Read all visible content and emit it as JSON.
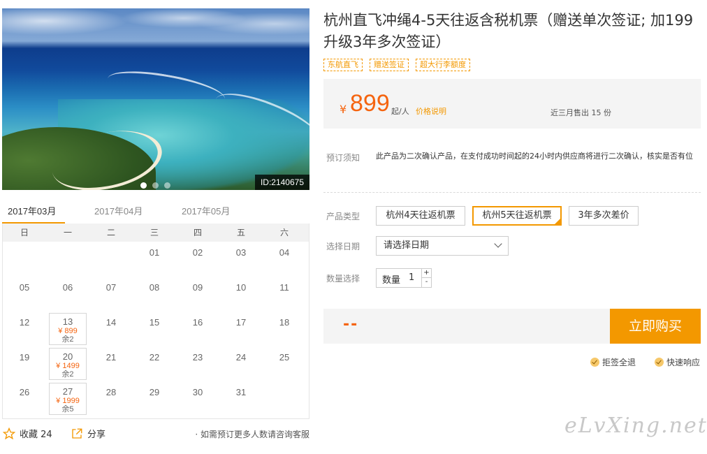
{
  "hero": {
    "id_badge": "ID:2140675",
    "slide_count": 3,
    "active_slide": 0
  },
  "months": [
    "2017年03月",
    "2017年04月",
    "2017年05月"
  ],
  "weekdays": [
    "日",
    "一",
    "二",
    "三",
    "四",
    "五",
    "六"
  ],
  "calendar": {
    "rows": [
      [
        {
          "d": ""
        },
        {
          "d": ""
        },
        {
          "d": ""
        },
        {
          "d": "01"
        },
        {
          "d": "02"
        },
        {
          "d": "03"
        },
        {
          "d": "04"
        }
      ],
      [
        {
          "d": "05"
        },
        {
          "d": "06"
        },
        {
          "d": "07"
        },
        {
          "d": "08"
        },
        {
          "d": "09"
        },
        {
          "d": "10"
        },
        {
          "d": "11"
        }
      ],
      [
        {
          "d": "12"
        },
        {
          "d": "13",
          "price": "¥ 899",
          "left": "余2"
        },
        {
          "d": "14"
        },
        {
          "d": "15"
        },
        {
          "d": "16"
        },
        {
          "d": "17"
        },
        {
          "d": "18"
        }
      ],
      [
        {
          "d": "19"
        },
        {
          "d": "20",
          "price": "¥ 1499",
          "left": "余2"
        },
        {
          "d": "21"
        },
        {
          "d": "22"
        },
        {
          "d": "23"
        },
        {
          "d": "24"
        },
        {
          "d": "25"
        }
      ],
      [
        {
          "d": "26"
        },
        {
          "d": "27",
          "price": "¥ 1999",
          "left": "余5"
        },
        {
          "d": "28"
        },
        {
          "d": "29"
        },
        {
          "d": "30"
        },
        {
          "d": "31"
        },
        {
          "d": ""
        }
      ]
    ]
  },
  "footer": {
    "fav_label": "收藏 24",
    "share_label": "分享",
    "more_note": "· 如需预订更多人数请咨询客服"
  },
  "product": {
    "title": "杭州直飞冲绳4-5天往返含税机票（赠送单次签证; 加199升级3年多次签证）",
    "tags": [
      "东航直飞",
      "赠送签证",
      "超大行李额度"
    ],
    "currency": "¥",
    "price": "899",
    "per": "起/人",
    "price_note": "价格说明",
    "sold": "近三月售出 15 份",
    "notice_label": "预订须知",
    "notice_text": "此产品为二次确认产品，在支付成功时间起的24小时内供应商将进行二次确认，核实是否有位",
    "type_label": "产品类型",
    "types": [
      "杭州4天往返机票",
      "杭州5天往返机票",
      "3年多次差价"
    ],
    "date_label": "选择日期",
    "date_placeholder": "请选择日期",
    "qty_label": "数量选择",
    "qty_inner_label": "数量",
    "qty_value": "1",
    "qty_plus": "+",
    "qty_minus": "-",
    "total": "--",
    "buy_label": "立即购买",
    "guarantees": [
      "拒签全退",
      "快速响应"
    ]
  },
  "watermark": "eLvXing.net",
  "colors": {
    "accent": "#f39800",
    "price": "#f5640f"
  }
}
